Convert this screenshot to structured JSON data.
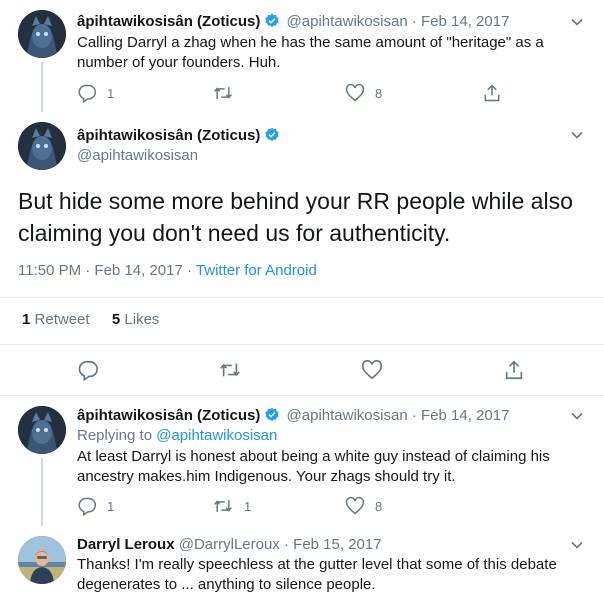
{
  "colors": {
    "accent": "#1b95e0",
    "muted": "#657786",
    "text": "#14171a",
    "divider": "#e6ecf0",
    "verified": "#1da1f2"
  },
  "icons": [
    "reply-icon",
    "retweet-icon",
    "like-icon",
    "share-icon",
    "verified-icon",
    "chevron-down-icon"
  ],
  "tweets": [
    {
      "name": "âpihtawikosisân (Zoticus)",
      "handle": "@apihtawikosisan",
      "separator": "·",
      "date": "Feb 14, 2017",
      "text": "Calling Darryl a zhag when he has the same amount of \"heritage\" as a number of your founders. Huh.",
      "replies": "1",
      "retweets": "",
      "likes": "8"
    },
    {
      "name": "âpihtawikosisân (Zoticus)",
      "handle": "@apihtawikosisan",
      "text": "But hide some more behind your RR people while also claiming you don't need us for authenticity.",
      "time": "11:50 PM · Feb 14, 2017",
      "meta_separator": "·",
      "client": "Twitter for Android",
      "retweet_count": "1",
      "retweet_label": "Retweet",
      "like_count": "5",
      "like_label": "Likes"
    },
    {
      "name": "âpihtawikosisân (Zoticus)",
      "handle": "@apihtawikosisan",
      "separator": "·",
      "date": "Feb 14, 2017",
      "replying_label": "Replying to",
      "replying_to": "@apihtawikosisan",
      "text": "At least Darryl is honest about being a white guy instead of claiming his ancestry makes.him Indigenous. Your zhags should try it.",
      "replies": "1",
      "retweets": "1",
      "likes": "8"
    },
    {
      "name": "Darryl Leroux",
      "handle": "@DarrylLeroux",
      "separator": "·",
      "date": "Feb 15, 2017",
      "text": "Thanks! I'm really speechless at the gutter level that some of this debate degenerates to ... anything to silence people."
    }
  ]
}
